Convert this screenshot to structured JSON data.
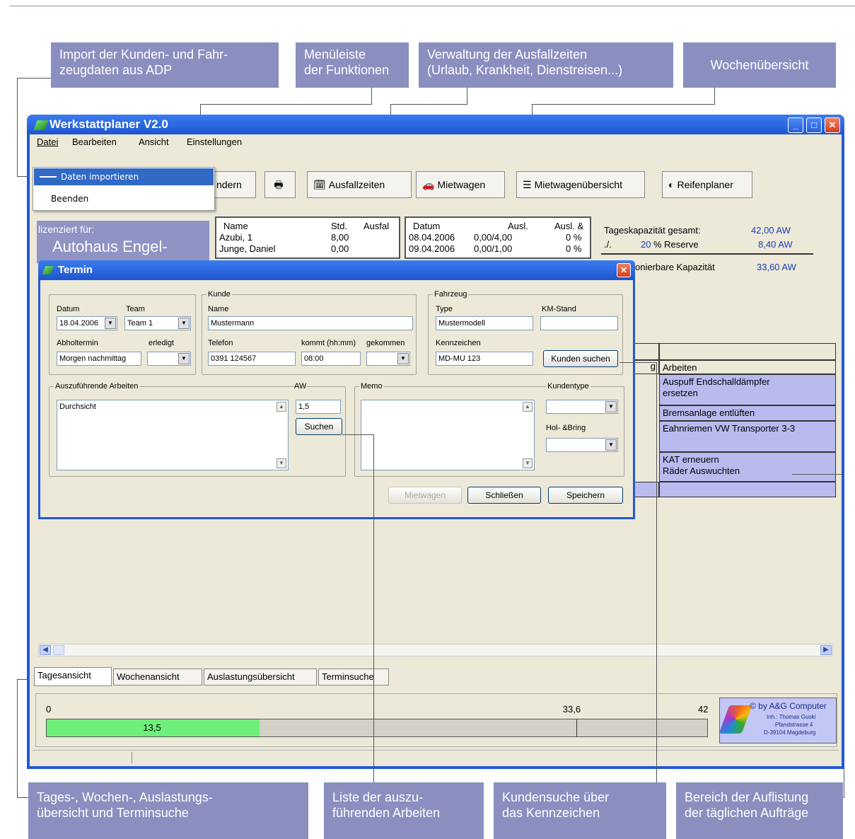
{
  "callouts": {
    "import": "Import der Kunden- und Fahr-\nzeugdaten aus ADP",
    "menu": "Menüleiste\nder Funktionen",
    "ausfall": "Verwaltung der Ausfallzeiten\n(Urlaub, Krankheit, Dienstreisen...)",
    "woche": "Wochenübersicht",
    "tages": "Tages-, Wochen-, Auslastungs-\nübersicht und Terminsuche",
    "liste": "Liste der auszu-\nführenden Arbeiten",
    "kundensuche": "Kundensuche über\ndas Kennzeichen",
    "bereich": "Bereich der Auflistung\nder täglichen Aufträge"
  },
  "window": {
    "title": "Werkstattplaner V2.0"
  },
  "menubar": {
    "items": [
      "Datei",
      "Bearbeiten",
      "Ansicht",
      "Einstellungen"
    ]
  },
  "file_menu": {
    "import": "Daten importieren",
    "exit": "Beenden"
  },
  "toolbar": {
    "aendern": "ndern",
    "ausfallzeiten": "Ausfallzeiten",
    "mietwagen": "Mietwagen",
    "mietwagenuebersicht": "Mietwagenübersicht",
    "reifenplaner": "Reifenplaner"
  },
  "license": {
    "label": "lizenziert für:",
    "name": "Autohaus Engel-"
  },
  "staff_table": {
    "headers": [
      "Name",
      "Std.",
      "Ausfal"
    ],
    "rows": [
      {
        "name": "Azubi, 1",
        "std": "8,00"
      },
      {
        "name": "Junge, Daniel",
        "std": "0,00"
      }
    ]
  },
  "absence_table": {
    "headers": [
      "Datum",
      "Ausl.",
      "Ausl. &"
    ],
    "rows": [
      {
        "datum": "08.04.2006",
        "ausl": "0,00/4,00",
        "pct": "0 %"
      },
      {
        "datum": "09.04.2006",
        "ausl": "0,00/1,00",
        "pct": "0 %"
      }
    ]
  },
  "capacity": {
    "total_label": "Tageskapazität gesamt:",
    "total_value": "42,00 AW",
    "reserve_prefix": "./.",
    "reserve_pct": "20",
    "reserve_label": "% Reserve",
    "reserve_value": "8,40 AW",
    "disp_label": "Disponierbare Kapazität",
    "disp_label_visible": "onierbare Kapazität",
    "disp_value": "33,60 AW"
  },
  "work_list": {
    "col_left": "g",
    "header": "Arbeiten",
    "rows": [
      "Auspuff Endschalldämpfer\nersetzen",
      "Bremsanlage entlüften",
      "Eahnriemen VW Transporter 3-3",
      "KAT erneuern\nRäder Auswuchten",
      ""
    ]
  },
  "dialog": {
    "title": "Termin",
    "datum_label": "Datum",
    "datum": "18.04.2006",
    "team_label": "Team",
    "team": "Team 1",
    "abholtermin_label": "Abholtermin",
    "abholtermin": "Morgen nachmittag",
    "erledigt_label": "erledigt",
    "kunde_group": "Kunde",
    "name_label": "Name",
    "name": "Mustermann",
    "telefon_label": "Telefon",
    "telefon": "0391 124567",
    "kommt_label": "kommt (hh:mm)",
    "kommt": "08:00",
    "gekommen_label": "gekommen",
    "fahrzeug_group": "Fahrzeug",
    "type_label": "Type",
    "type": "Mustermodell",
    "km_label": "KM-Stand",
    "kennzeichen_label": "Kennzeichen",
    "kennzeichen": "MD-MU 123",
    "kunden_suchen": "Kunden suchen",
    "arbeiten_label": "Auszuführende Arbeiten",
    "arbeiten": "Durchsicht",
    "aw_label": "AW",
    "aw": "1,5",
    "suchen": "Suchen",
    "memo_label": "Memo",
    "kundentyp_label": "Kundentype",
    "holbring_label": "Hol- &Bring",
    "btn_mietwagen": "Mietwagen",
    "btn_schliessen": "Schließen",
    "btn_speichern": "Speichern"
  },
  "tabs": [
    "Tagesansicht",
    "Wochenansicht",
    "Auslastungsübersicht",
    "Terminsuche"
  ],
  "capacity_bar": {
    "min": "0",
    "marker_label": "33,6",
    "max": "42",
    "value_label": "13,5",
    "value": 13.5,
    "marker": 33.6,
    "total": 42
  },
  "logo": {
    "line1": "© by A&G Computer",
    "line2": "Inh.: Thomas Guski",
    "line3": "Pfandstrasse 4",
    "line4": "D-39104 Magdeburg"
  }
}
